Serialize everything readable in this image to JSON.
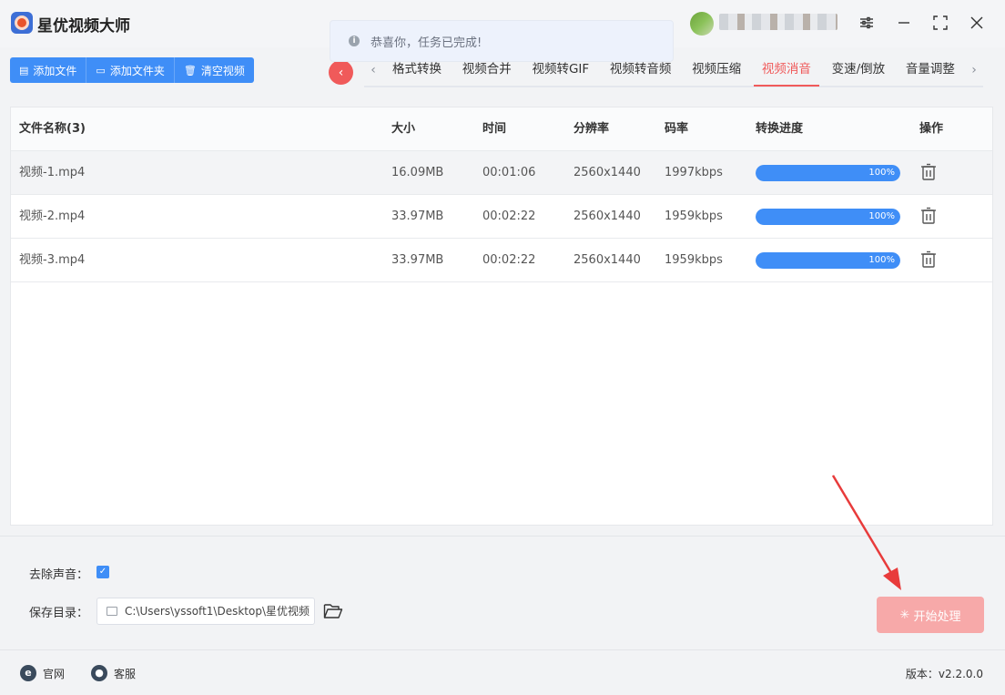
{
  "app": {
    "title": "星优视频大师",
    "toast": "恭喜你，任务已完成!"
  },
  "toolbar": {
    "add_file": "添加文件",
    "add_folder": "添加文件夹",
    "clear_videos": "清空视频"
  },
  "tabs": [
    {
      "label": "格式转换",
      "active": false
    },
    {
      "label": "视频合并",
      "active": false
    },
    {
      "label": "视频转GIF",
      "active": false
    },
    {
      "label": "视频转音频",
      "active": false
    },
    {
      "label": "视频压缩",
      "active": false
    },
    {
      "label": "视频消音",
      "active": true
    },
    {
      "label": "变速/倒放",
      "active": false
    },
    {
      "label": "音量调整",
      "active": false
    }
  ],
  "table": {
    "headers": {
      "name": "文件名称(3)",
      "size": "大小",
      "time": "时间",
      "resolution": "分辨率",
      "bitrate": "码率",
      "progress": "转换进度",
      "action": "操作"
    },
    "rows": [
      {
        "name": "视频-1.mp4",
        "size": "16.09MB",
        "time": "00:01:06",
        "resolution": "2560x1440",
        "bitrate": "1997kbps",
        "progress": 1.0,
        "progress_label": "100%"
      },
      {
        "name": "视频-2.mp4",
        "size": "33.97MB",
        "time": "00:02:22",
        "resolution": "2560x1440",
        "bitrate": "1959kbps",
        "progress": 1.0,
        "progress_label": "100%"
      },
      {
        "name": "视频-3.mp4",
        "size": "33.97MB",
        "time": "00:02:22",
        "resolution": "2560x1440",
        "bitrate": "1959kbps",
        "progress": 1.0,
        "progress_label": "100%"
      }
    ]
  },
  "options": {
    "remove_audio_label": "去除声音：",
    "remove_audio_checked": true,
    "save_dir_label": "保存目录：",
    "save_dir_value": "C:\\Users\\yssoft1\\Desktop\\星优视频"
  },
  "start_button": "开始处理",
  "footer": {
    "website": "官网",
    "support": "客服",
    "version": "版本：v2.2.0.0"
  },
  "colors": {
    "accent_blue": "#3f8ef7",
    "accent_red": "#f05a5a",
    "start_button_disabled": "#f7a9a9"
  }
}
